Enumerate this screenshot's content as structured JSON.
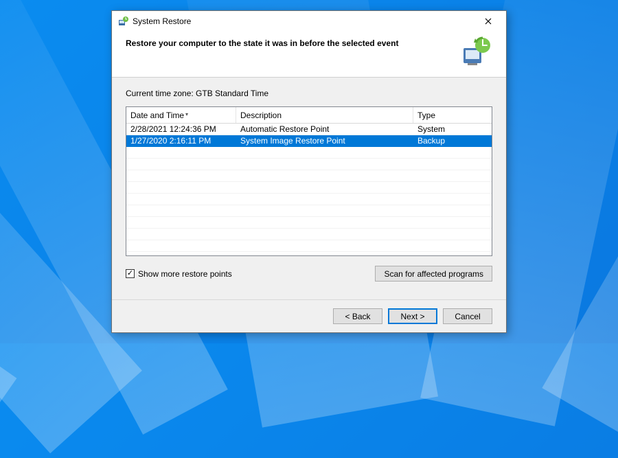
{
  "window": {
    "title": "System Restore",
    "heading": "Restore your computer to the state it was in before the selected event"
  },
  "timezone_label": "Current time zone: GTB Standard Time",
  "columns": {
    "date": "Date and Time",
    "desc": "Description",
    "type": "Type"
  },
  "rows": [
    {
      "date": "2/28/2021 12:24:36 PM",
      "desc": "Automatic Restore Point",
      "type": "System",
      "selected": false
    },
    {
      "date": "1/27/2020 2:16:11 PM",
      "desc": "System Image Restore Point",
      "type": "Backup",
      "selected": true
    }
  ],
  "checkbox": {
    "checked": true,
    "label": "Show more restore points"
  },
  "buttons": {
    "scan": "Scan for affected programs",
    "back": "< Back",
    "next": "Next >",
    "cancel": "Cancel"
  }
}
